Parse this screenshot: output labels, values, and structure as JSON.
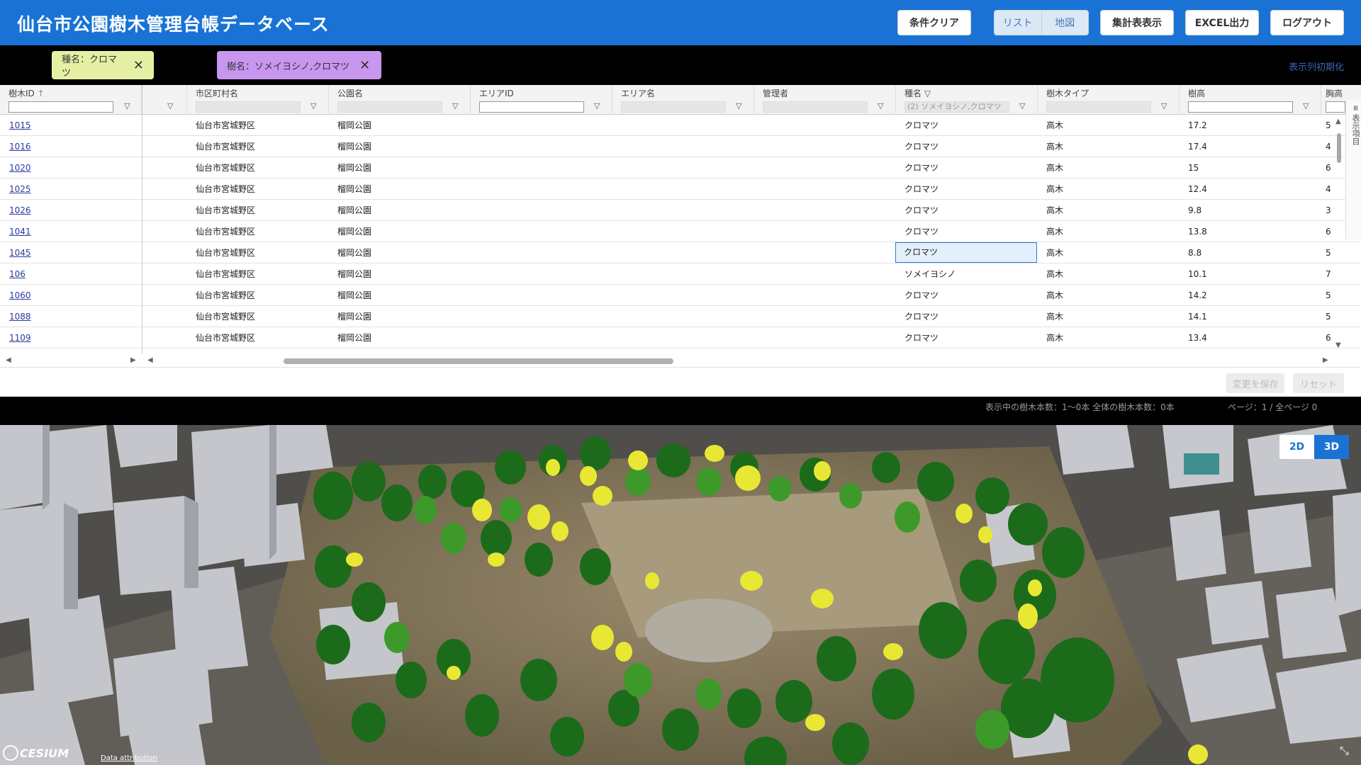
{
  "header": {
    "title": "仙台市公園樹木管理台帳データベース",
    "buttons": {
      "clear": "条件クリア",
      "list": "リスト",
      "map": "地図",
      "summary": "集計表表示",
      "excel": "EXCEL出力",
      "logout": "ログアウト"
    }
  },
  "filters": {
    "chips": [
      {
        "label": "種名：クロマツ"
      },
      {
        "label": "樹名：ソメイヨシノ,クロマツ"
      }
    ],
    "reset_columns": "表示列初期化"
  },
  "grid": {
    "columns": [
      "樹木ID",
      "市区町村名",
      "公園名",
      "エリアID",
      "エリア名",
      "管理者",
      "種名",
      "樹木タイプ",
      "樹高",
      "胸高"
    ],
    "sort_indicator": "↑",
    "species_filter_value": "(2) ソメイヨシノ,クロマツ",
    "rows": [
      {
        "id": "1015",
        "city": "仙台市宮城野区",
        "park": "榴岡公園",
        "species": "クロマツ",
        "type": "高木",
        "height": "17.2",
        "girth": "5"
      },
      {
        "id": "1016",
        "city": "仙台市宮城野区",
        "park": "榴岡公園",
        "species": "クロマツ",
        "type": "高木",
        "height": "17.4",
        "girth": "4"
      },
      {
        "id": "1020",
        "city": "仙台市宮城野区",
        "park": "榴岡公園",
        "species": "クロマツ",
        "type": "高木",
        "height": "15",
        "girth": "6"
      },
      {
        "id": "1025",
        "city": "仙台市宮城野区",
        "park": "榴岡公園",
        "species": "クロマツ",
        "type": "高木",
        "height": "12.4",
        "girth": "4"
      },
      {
        "id": "1026",
        "city": "仙台市宮城野区",
        "park": "榴岡公園",
        "species": "クロマツ",
        "type": "高木",
        "height": "9.8",
        "girth": "3"
      },
      {
        "id": "1041",
        "city": "仙台市宮城野区",
        "park": "榴岡公園",
        "species": "クロマツ",
        "type": "高木",
        "height": "13.8",
        "girth": "6"
      },
      {
        "id": "1045",
        "city": "仙台市宮城野区",
        "park": "榴岡公園",
        "species": "クロマツ",
        "type": "高木",
        "height": "8.8",
        "girth": "5"
      },
      {
        "id": "106",
        "city": "仙台市宮城野区",
        "park": "榴岡公園",
        "species": "ソメイヨシノ",
        "type": "高木",
        "height": "10.1",
        "girth": "7"
      },
      {
        "id": "1060",
        "city": "仙台市宮城野区",
        "park": "榴岡公園",
        "species": "クロマツ",
        "type": "高木",
        "height": "14.2",
        "girth": "5"
      },
      {
        "id": "1088",
        "city": "仙台市宮城野区",
        "park": "榴岡公園",
        "species": "クロマツ",
        "type": "高木",
        "height": "14.1",
        "girth": "5"
      },
      {
        "id": "1109",
        "city": "仙台市宮城野区",
        "park": "榴岡公園",
        "species": "クロマツ",
        "type": "高木",
        "height": "13.4",
        "girth": "6"
      }
    ],
    "side_tab": "表示項目",
    "save": "変更を保存",
    "reset": "リセット"
  },
  "status": {
    "count": "表示中の樹木本数：1～0本 全体の樹木本数：0本",
    "page": "ページ：1 / 全ページ 0"
  },
  "map": {
    "btn_2d": "2D",
    "btn_3d": "3D",
    "logo": "CESIUM",
    "attribution": "Data attribution"
  },
  "colors": {
    "header": "#1a73d4",
    "chip1": "#e6f0a4",
    "chip2": "#c796ef"
  }
}
